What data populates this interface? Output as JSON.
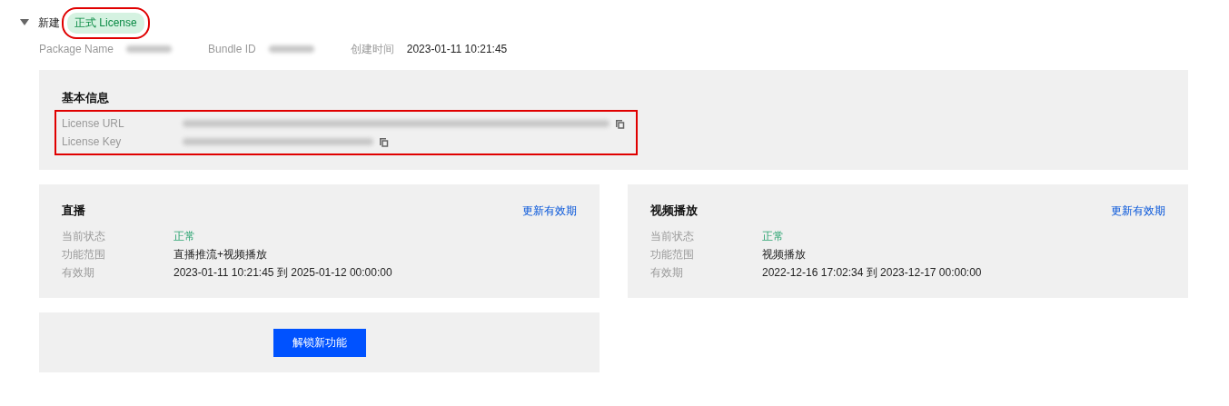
{
  "header": {
    "expanded": true,
    "title": "新建",
    "badge": {
      "label": "正式 License",
      "highlighted": true
    }
  },
  "meta": [
    {
      "label": "Package Name",
      "blurred": true
    },
    {
      "label": "Bundle ID",
      "blurred": true
    },
    {
      "label": "创建时间",
      "value": "2023-01-11 10:21:45"
    }
  ],
  "basic_info": {
    "title": "基本信息",
    "highlighted": true,
    "fields": [
      {
        "label": "License URL",
        "kind": "url",
        "blurred": true
      },
      {
        "label": "License Key",
        "kind": "key",
        "blurred": true
      }
    ]
  },
  "services": [
    {
      "title": "直播",
      "action": "更新有效期",
      "rows": [
        {
          "label": "当前状态",
          "value": "正常",
          "kind": "status"
        },
        {
          "label": "功能范围",
          "value": "直播推流+视频播放",
          "kind": "text"
        },
        {
          "label": "有效期",
          "value": "2023-01-11 10:21:45 到 2025-01-12 00:00:00",
          "kind": "text"
        }
      ]
    },
    {
      "title": "视频播放",
      "action": "更新有效期",
      "rows": [
        {
          "label": "当前状态",
          "value": "正常",
          "kind": "status"
        },
        {
          "label": "功能范围",
          "value": "视频播放",
          "kind": "text"
        },
        {
          "label": "有效期",
          "value": "2022-12-16 17:02:34 到 2023-12-17 00:00:00",
          "kind": "text"
        }
      ]
    }
  ],
  "unlock_button": "解锁新功能"
}
